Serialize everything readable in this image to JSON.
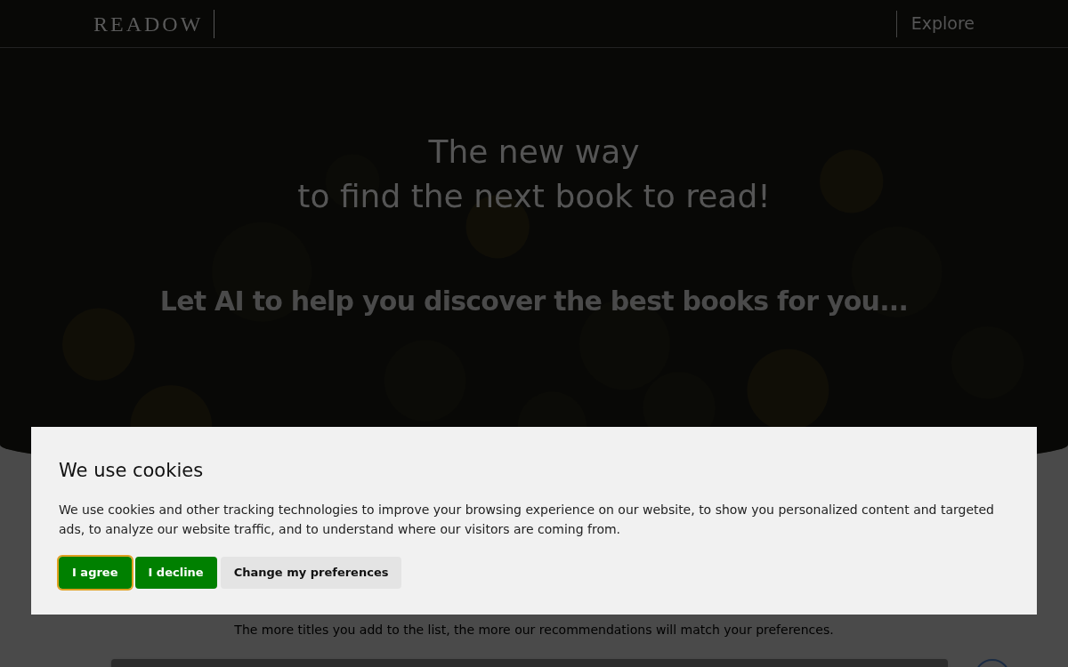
{
  "header": {
    "logo": "READOW",
    "nav": [
      "Explore"
    ]
  },
  "hero": {
    "title_lines": [
      "The new way",
      "to find the next book to read!"
    ],
    "subtitle": "Let AI to help you discover the best books for you..."
  },
  "below": {
    "hint": "The more titles you add to the list, the more our recommendations will match your preferences."
  },
  "cookie_banner": {
    "title": "We use cookies",
    "text": "We use cookies and other tracking technologies to improve your browsing experience on our website, to show you personalized content and targeted ads, to analyze our website traffic, and to understand where our visitors are coming from.",
    "buttons": [
      {
        "label": "I agree",
        "kind": "primary",
        "focused": true
      },
      {
        "label": "I decline",
        "kind": "primary",
        "focused": false
      },
      {
        "label": "Change my preferences",
        "kind": "secondary",
        "focused": false
      }
    ]
  }
}
